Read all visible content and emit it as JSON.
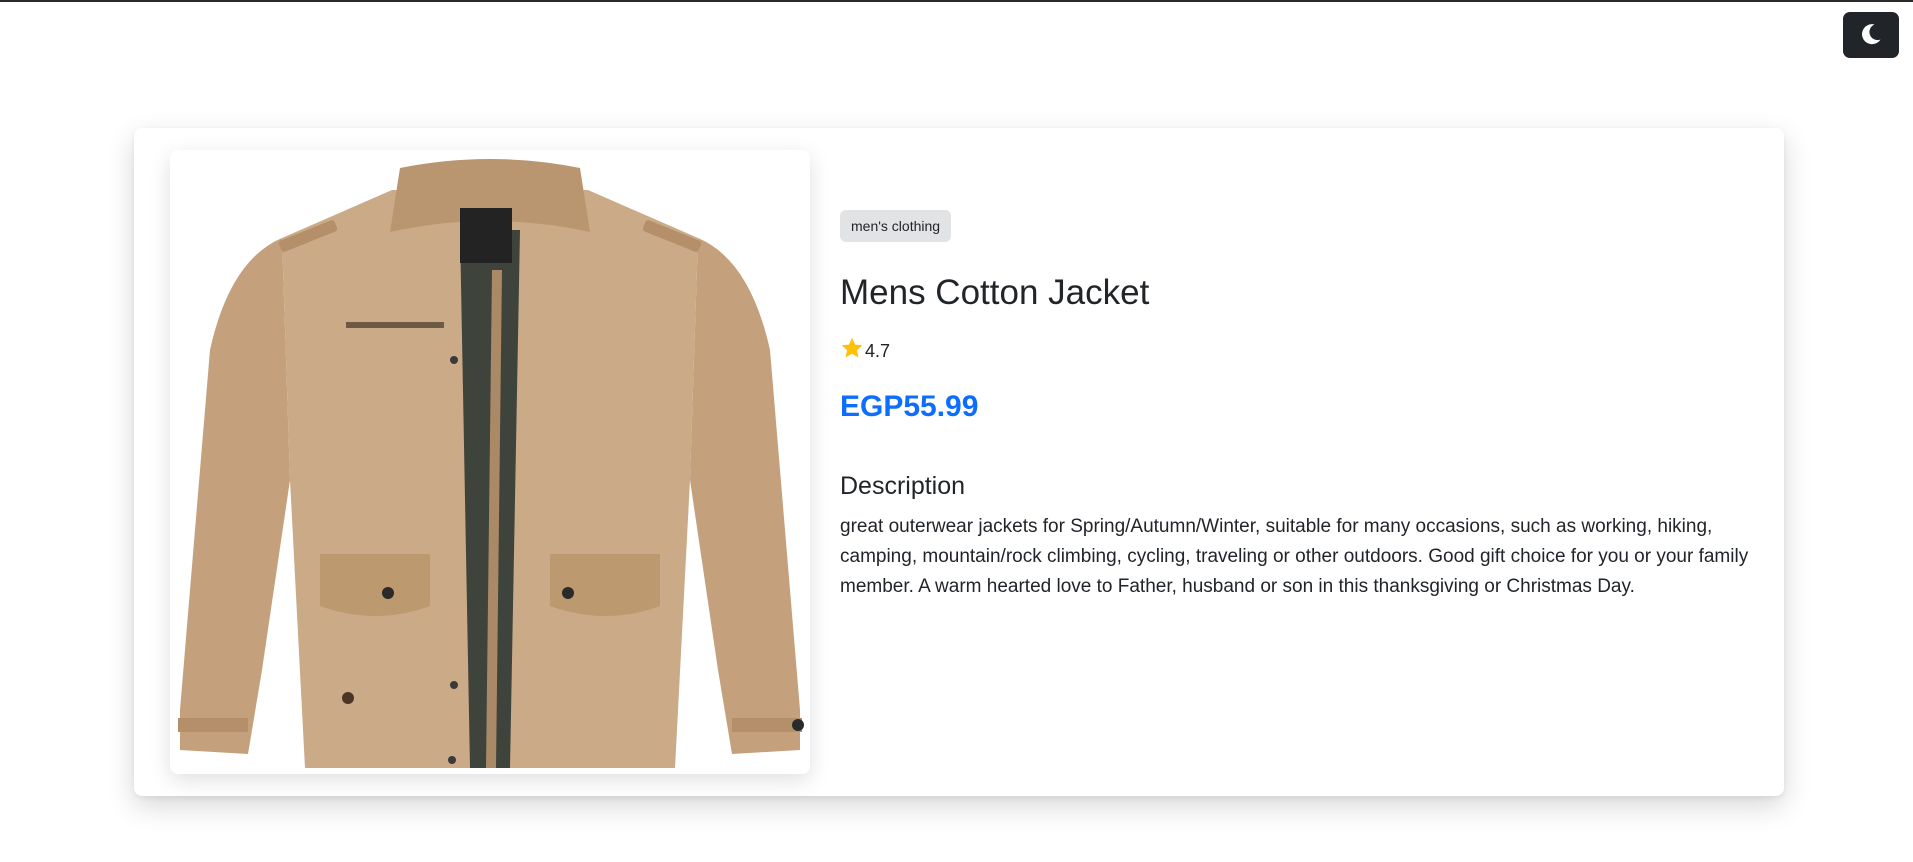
{
  "theme_toggle": {
    "icon": "moon-icon"
  },
  "product": {
    "category": "men's clothing",
    "title": "Mens Cotton Jacket",
    "rating": "4.7",
    "price": "EGP55.99",
    "description_heading": "Description",
    "description": "great outerwear jackets for Spring/Autumn/Winter, suitable for many occasions, such as working, hiking, camping, mountain/rock climbing, cycling, traveling or other outdoors. Good gift choice for you or your family member. A warm hearted love to Father, husband or son in this thanksgiving or Christmas Day.",
    "image": "jacket-image"
  },
  "colors": {
    "accent": "#0d6efd",
    "star": "#ffc107",
    "badge_bg": "#e2e3e5",
    "toggle_bg": "#212529",
    "jacket": "#c9a886"
  }
}
